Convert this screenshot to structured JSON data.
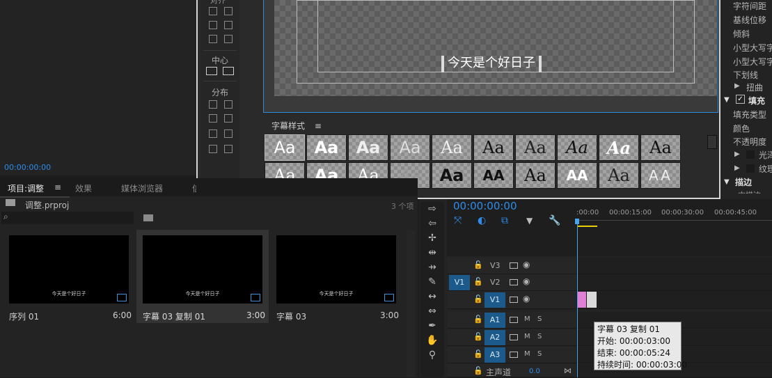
{
  "source_monitor": {
    "timecode": "00:00:00:00"
  },
  "title_window": {
    "align_header_partial": "对齐",
    "center_label": "中心",
    "distribute_label": "分布",
    "subtitle_text": "今天是个好日子",
    "styles_label": "字幕样式",
    "styles_menu_icon": "hamburger-icon",
    "style_swatches_row1": [
      "Aa",
      "Aa",
      "Aa",
      "Aa",
      "Aa",
      "Aa",
      "Aa",
      "Aa",
      "Aa",
      "Aa"
    ],
    "style_swatches_row2": [
      "Aa",
      "Aa",
      "Aa",
      "Aa",
      "Aa",
      "AA",
      "Aa",
      "AA",
      "Aa",
      "AA"
    ]
  },
  "properties": {
    "items": [
      "字符间距",
      "基线位移",
      "倾斜",
      "小型大写字",
      "小型大写字",
      "下划线",
      "扭曲"
    ],
    "fill_label": "填充",
    "fill_items": [
      "填充类型",
      "颜色",
      "不透明度"
    ],
    "sheen_label": "光泽",
    "texture_label": "纹理",
    "stroke_label": "描边",
    "inner_stroke_partial": "内描边"
  },
  "project": {
    "tabs": [
      "项目:调整",
      "效果",
      "媒体浏览器",
      "信"
    ],
    "active_tab": "项目:调整",
    "file": "调整.prproj",
    "item_count": "3 个项",
    "clips": [
      {
        "name": "序列 01",
        "duration": "6:00",
        "preview_text": "今天是个好日子"
      },
      {
        "name": "字幕 03 复制 01",
        "duration": "3:00",
        "preview_text": "今天是个好日子"
      },
      {
        "name": "字幕 03",
        "duration": "3:00",
        "preview_text": "今天是个好日子"
      }
    ]
  },
  "timeline": {
    "timecode": "00:00:00:00",
    "ruler": [
      ":00:00",
      "00:00:15:00",
      "00:00:30:00",
      "00:00:45:00"
    ],
    "source_patch": "V1",
    "video_tracks": [
      "V3",
      "V2",
      "V1"
    ],
    "audio_tracks": [
      "A1",
      "A2",
      "A3"
    ],
    "mute": "M",
    "solo": "S",
    "master_label": "主声道",
    "master_value": "0.0",
    "clip_colors": {
      "clip1": "#e07fd6",
      "clip2": "#d9d9d9"
    }
  },
  "tooltip": {
    "name": "字幕 03 复制 01",
    "start": "开始: 00:00:03:00",
    "end": "结束: 00:00:05:24",
    "duration": "持续时间: 00:00:03:00"
  }
}
